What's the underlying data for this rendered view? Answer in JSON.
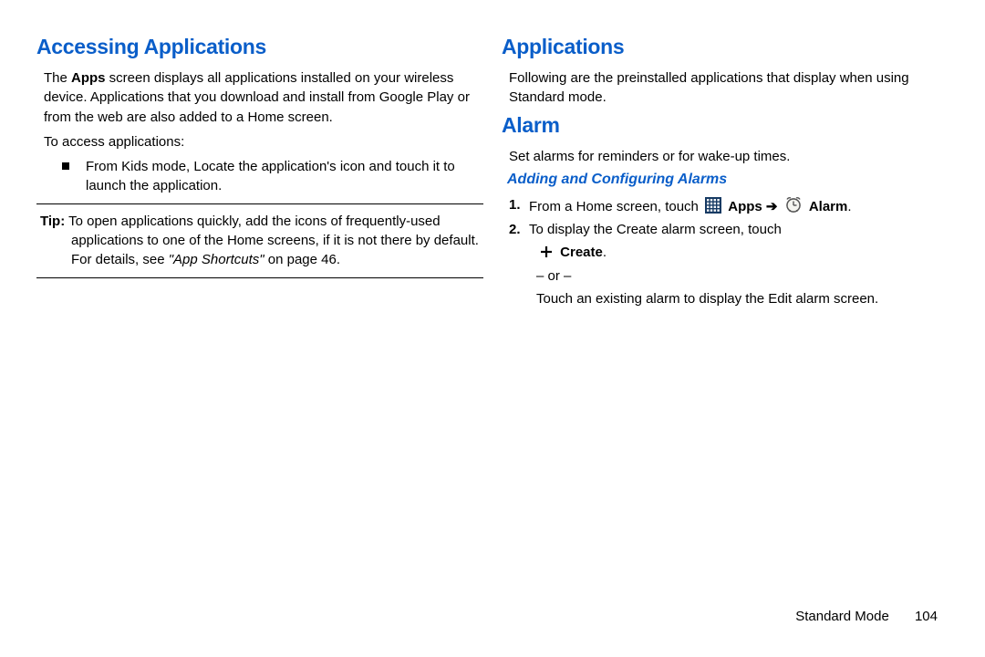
{
  "left": {
    "heading": "Accessing Applications",
    "p1a": "The ",
    "p1b": "Apps",
    "p1c": " screen displays all applications installed on your wireless device. Applications that you download and install from Google Play or from the web are also added to a Home screen.",
    "p2": "To access applications:",
    "bullet1": "From Kids mode, Locate the application's icon and touch it to launch the application.",
    "tip_label": "Tip:",
    "tip_a": " To open applications quickly, add the icons of frequently-used applications to one of the Home screens, if it is not there by default. For details, see ",
    "tip_b": "\"App Shortcuts\"",
    "tip_c": " on page 46."
  },
  "right": {
    "heading_apps": "Applications",
    "apps_intro": "Following are the preinstalled applications that display when using Standard mode.",
    "heading_alarm": "Alarm",
    "alarm_intro": "Set alarms for reminders or for wake-up times.",
    "sub_heading": "Adding and Configuring Alarms",
    "step1_a": "From a Home screen, touch ",
    "step1_apps": "Apps",
    "step1_arrow": " ➔ ",
    "step1_alarm": "Alarm",
    "step1_end": ".",
    "step2_a": "To display the Create alarm screen, touch",
    "step2_create": "Create",
    "step2_end": ".",
    "or": "– or –",
    "step2_b": "Touch an existing alarm to display the Edit alarm screen."
  },
  "footer": {
    "mode": "Standard Mode",
    "page": "104"
  }
}
